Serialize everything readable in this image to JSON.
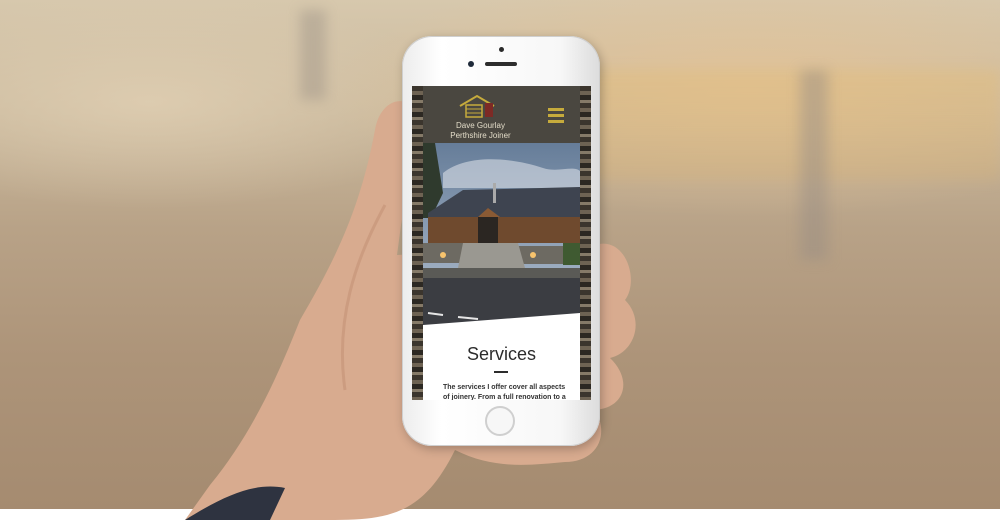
{
  "site": {
    "brand_line1": "Dave Gourlay",
    "brand_line2": "Perthshire Joiner",
    "menu_icon": "hamburger-menu-icon",
    "accent_color": "#c6ab3c"
  },
  "services": {
    "title": "Services",
    "text": "The services I offer cover all aspects of joinery. From a full renovation to a"
  }
}
